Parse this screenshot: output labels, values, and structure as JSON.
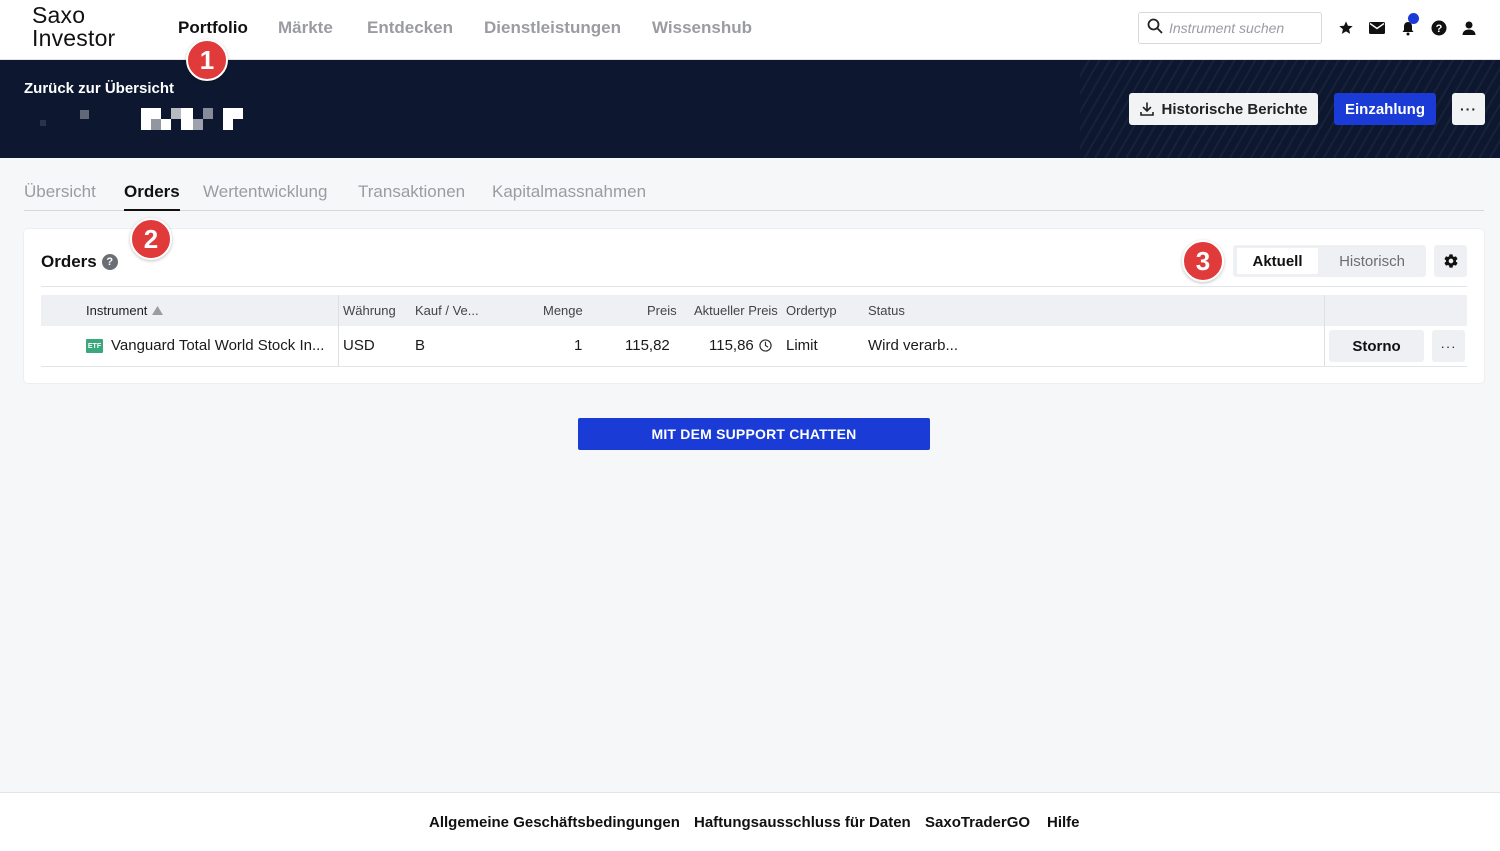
{
  "brand": {
    "line1": "Saxo",
    "line2": "Investor"
  },
  "nav": {
    "items": [
      "Portfolio",
      "Märkte",
      "Entdecken",
      "Dienstleistungen",
      "Wissenshub"
    ],
    "active": "Portfolio"
  },
  "search": {
    "placeholder": "Instrument suchen"
  },
  "top_icons": [
    "search-icon",
    "star-icon",
    "mail-icon",
    "notification-icon",
    "help-icon",
    "user-icon"
  ],
  "hero": {
    "back_label": "Zurück zur Übersicht",
    "historical_reports_label": "Historische Berichte",
    "deposit_label": "Einzahlung",
    "more_label": "···"
  },
  "tabs": [
    "Übersicht",
    "Orders",
    "Wertentwicklung",
    "Transaktionen",
    "Kapitalmassnahmen"
  ],
  "active_tab": "Orders",
  "orders": {
    "title": "Orders",
    "help": "?",
    "toggle": {
      "current": "Aktuell",
      "historical": "Historisch",
      "selected": "Aktuell"
    },
    "columns": {
      "instrument": "Instrument",
      "currency": "Währung",
      "side": "Kauf / Ve...",
      "quantity": "Menge",
      "price": "Preis",
      "current_price": "Aktueller Preis",
      "order_type": "Ordertyp",
      "status": "Status"
    },
    "rows": [
      {
        "badge": "ETF",
        "instrument": "Vanguard Total World Stock In...",
        "currency": "USD",
        "side": "B",
        "quantity": "1",
        "price": "115,82",
        "current_price": "115,86",
        "order_type": "Limit",
        "status": "Wird verarb...",
        "cancel_label": "Storno",
        "more_label": "···"
      }
    ]
  },
  "support_label": "MIT DEM SUPPORT CHATTEN",
  "footer": {
    "links": [
      "Allgemeine Geschäftsbedingungen",
      "Haftungsausschluss für Daten",
      "SaxoTraderGO",
      "Hilfe"
    ]
  },
  "annotations": [
    "1",
    "2",
    "3"
  ],
  "colors": {
    "primary": "#1a3bd6",
    "hero_bg": "#0d1830",
    "annotation": "#e03a3a",
    "etf_badge": "#3aa87c"
  }
}
